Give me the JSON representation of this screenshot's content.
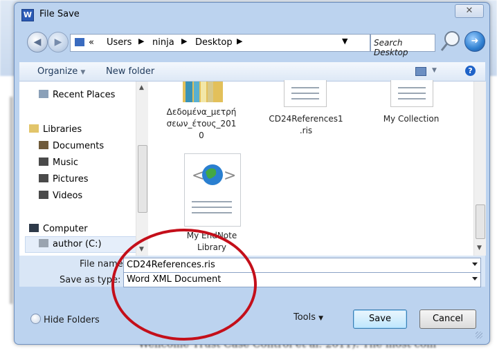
{
  "window": {
    "title": "File Save",
    "app_icon_letter": "W",
    "close_glyph": "✕"
  },
  "address_bar": {
    "breadcrumbs": [
      "«",
      "Users",
      "ninja",
      "Desktop"
    ],
    "search_placeholder": "Search Desktop"
  },
  "toolbar": {
    "organize_label": "Organize",
    "new_folder_label": "New folder"
  },
  "nav_pane": {
    "items": [
      {
        "label": "Recent Places",
        "icon": "recent-places-icon"
      },
      {
        "label": "Libraries",
        "icon": "libraries-icon"
      },
      {
        "label": "Documents",
        "icon": "documents-icon"
      },
      {
        "label": "Music",
        "icon": "music-icon"
      },
      {
        "label": "Pictures",
        "icon": "pictures-icon"
      },
      {
        "label": "Videos",
        "icon": "videos-icon"
      },
      {
        "label": "Computer",
        "icon": "computer-icon"
      },
      {
        "label": "author (C:)",
        "icon": "drive-icon"
      }
    ]
  },
  "files": [
    {
      "name": "Δεδομένα_μετρή σεων_έτους_2010",
      "lines": [
        "Δεδομένα_μετρή",
        "σεων_έτους_201",
        "0"
      ],
      "icon": "folder-icon"
    },
    {
      "name": "CD24References1.ris",
      "lines": [
        "CD24References1",
        ".ris"
      ],
      "icon": "document-icon"
    },
    {
      "name": "My Collection",
      "lines": [
        "My Collection"
      ],
      "icon": "document-icon"
    },
    {
      "name": "My EndNote Library",
      "lines": [
        "My EndNote",
        "Library"
      ],
      "icon": "endnote-library-icon"
    }
  ],
  "form": {
    "file_name_label": "File name:",
    "file_name_value": "CD24References.ris",
    "save_type_label": "Save as type:",
    "save_type_value": "Word XML Document"
  },
  "buttons": {
    "hide_folders": "Hide Folders",
    "tools": "Tools",
    "save": "Save",
    "cancel": "Cancel"
  },
  "background": {
    "doc_text": "Wellcome Trust Case Control et al. 2011). The most com"
  },
  "colors": {
    "annotation_ellipse": "#c40f1a",
    "dialog_frame": "#bcd3ef",
    "save_button": "#bee6fd"
  }
}
